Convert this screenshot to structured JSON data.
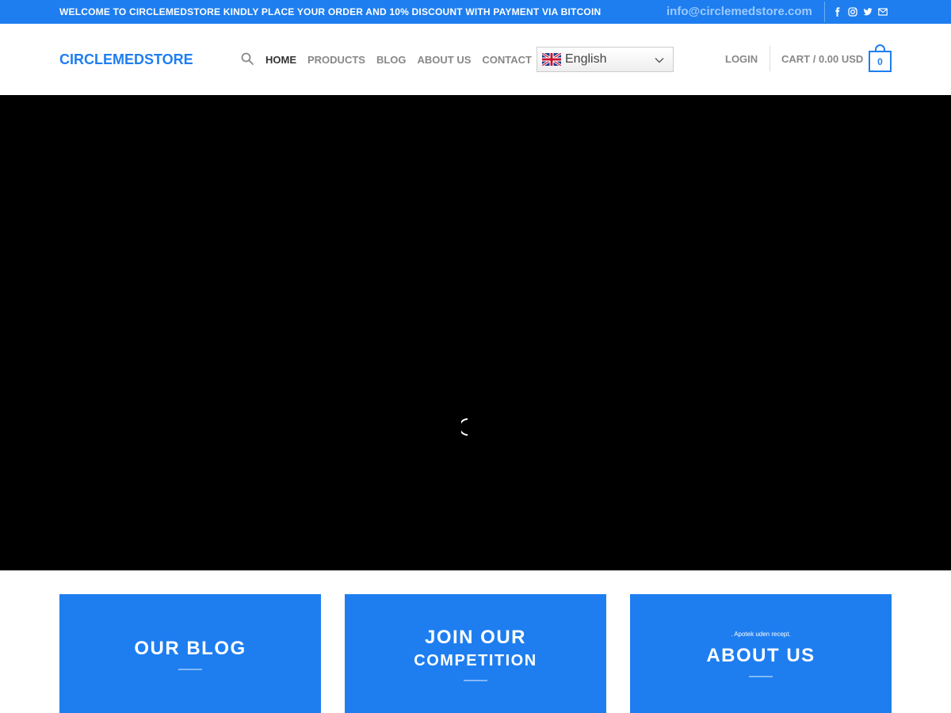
{
  "topbar": {
    "welcome": "WELCOME TO CIRCLEMEDSTORE KINDLY PLACE YOUR ORDER AND 10% DISCOUNT WITH PAYMENT VIA BITCOIN",
    "email": "info@circlemedstore.com",
    "social_icons": [
      "facebook-icon",
      "instagram-icon",
      "twitter-icon",
      "email-icon"
    ]
  },
  "header": {
    "logo": "CIRCLEMEDSTORE",
    "nav": [
      "HOME",
      "PRODUCTS",
      "BLOG",
      "ABOUT US",
      "CONTACT"
    ],
    "language": "English",
    "login": "LOGIN",
    "cart_label": "CART / 0.00 USD",
    "cart_count": "0"
  },
  "boxes": {
    "blog": "OUR BLOG",
    "competition_line1": "JOIN OUR",
    "competition_line2": "COMPETITION",
    "about_small": ". Apotek uden recept.",
    "about": "ABOUT US"
  },
  "colors": {
    "brand": "#1e7ef0",
    "hero_bg": "#000000"
  }
}
